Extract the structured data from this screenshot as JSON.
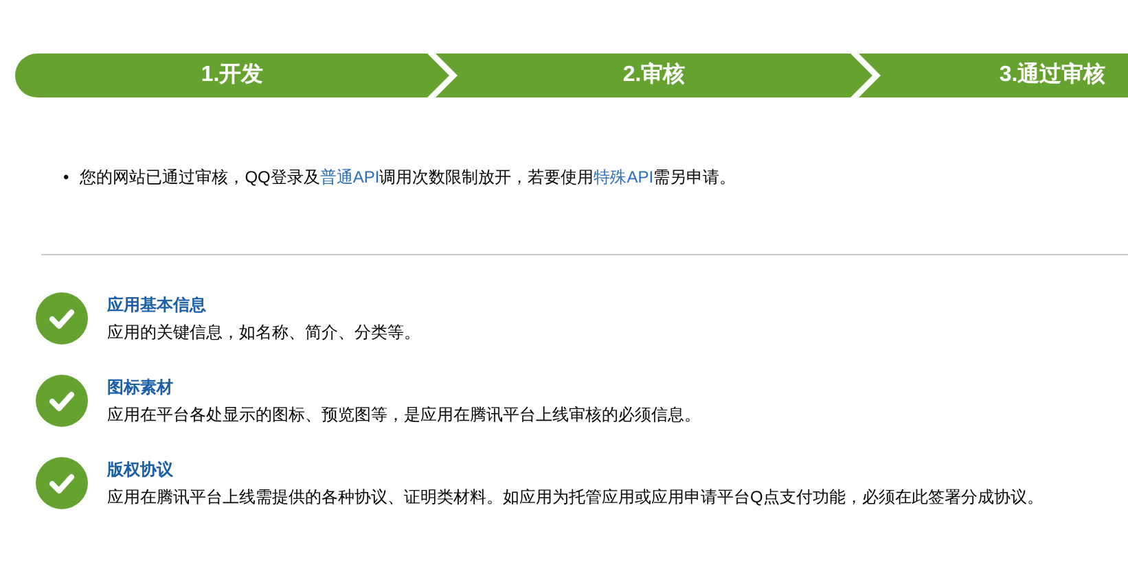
{
  "steps": [
    {
      "label": "1.开发"
    },
    {
      "label": "2.审核"
    },
    {
      "label": "3.通过审核"
    }
  ],
  "notice": {
    "bullet": "•",
    "parts": [
      {
        "text": "您的网站已通过审核，QQ登录及",
        "kind": "text"
      },
      {
        "text": "普通API",
        "kind": "link"
      },
      {
        "text": "调用次数限制放开，若要使用",
        "kind": "text"
      },
      {
        "text": "特殊API",
        "kind": "link"
      },
      {
        "text": "需另申请。",
        "kind": "text"
      }
    ]
  },
  "items": [
    {
      "title": "应用基本信息",
      "description": "应用的关键信息，如名称、简介、分类等。"
    },
    {
      "title": "图标素材",
      "description": "应用在平台各处显示的图标、预览图等，是应用在腾讯平台上线审核的必须信息。"
    },
    {
      "title": "版权协议",
      "description": "应用在腾讯平台上线需提供的各种协议、证明类材料。如应用为托管应用或应用申请平台Q点支付功能，必须在此签署分成协议。"
    }
  ]
}
